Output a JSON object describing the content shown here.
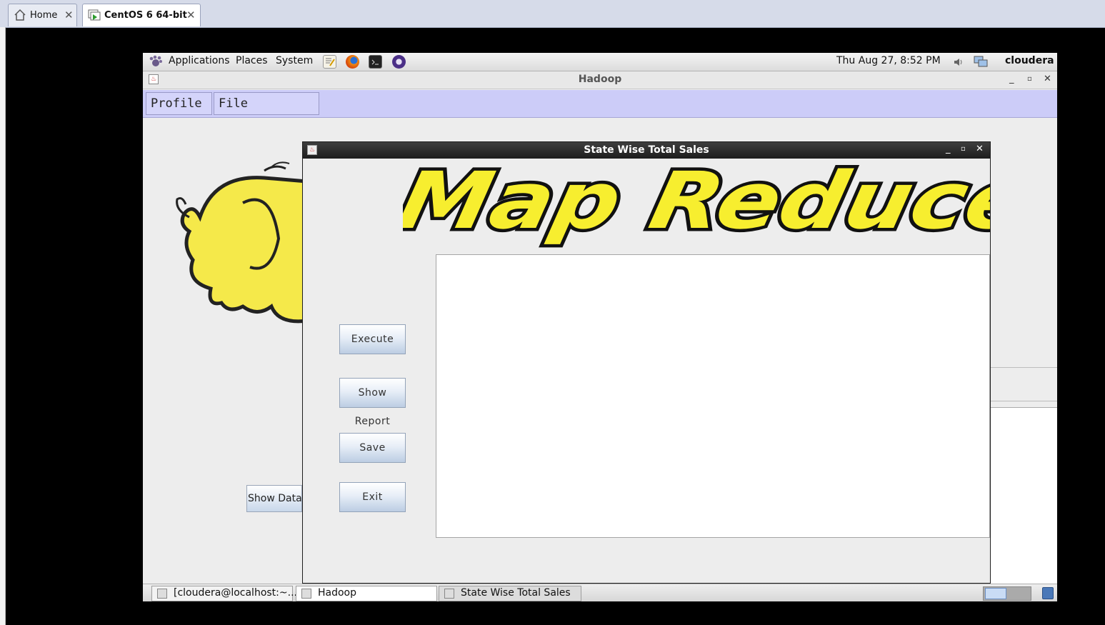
{
  "host": {
    "tabs": [
      {
        "label": "Home",
        "icon": "home-icon"
      },
      {
        "label": "CentOS 6 64-bit",
        "icon": "vm-running-icon"
      }
    ]
  },
  "gnome": {
    "menus": [
      "Applications",
      "Places",
      "System"
    ],
    "launchers": [
      "text-editor-icon",
      "firefox-icon",
      "terminal-icon",
      "eclipse-icon"
    ],
    "clock": "Thu Aug 27,  8:52 PM",
    "user": "cloudera"
  },
  "hadoop_window": {
    "title": "Hadoop",
    "menu": [
      "Profile",
      "File"
    ],
    "show_data_label": "Show Data"
  },
  "dialog": {
    "title": "State Wise Total Sales",
    "banner_text": "Map Reduce",
    "buttons": {
      "execute": "Execute",
      "show_report": "Show Report",
      "save": "Save",
      "exit": "Exit"
    },
    "report_text": ""
  },
  "taskbar": {
    "items": [
      {
        "label": "[cloudera@localhost:~..."
      },
      {
        "label": "Hadoop"
      },
      {
        "label": "State Wise Total Sales"
      }
    ]
  },
  "colors": {
    "menubar": "#ccccf8",
    "dialog_title": "#2a2a2a",
    "banner_yellow": "#f7ee2f",
    "elephant_yellow": "#f5e94a"
  }
}
